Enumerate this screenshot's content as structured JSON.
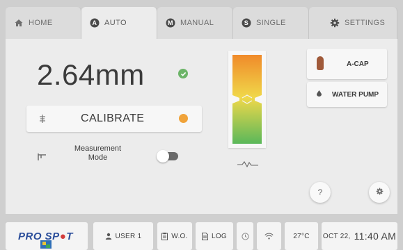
{
  "tabs": [
    {
      "label": "HOME",
      "icon": "home-icon",
      "active": false
    },
    {
      "label": "AUTO",
      "icon": "auto-a-icon",
      "active": true
    },
    {
      "label": "MANUAL",
      "icon": "manual-m-icon",
      "active": false
    },
    {
      "label": "SINGLE",
      "icon": "single-s-icon",
      "active": false
    },
    {
      "label": "SETTINGS",
      "icon": "gear-icon",
      "active": false
    }
  ],
  "main": {
    "measurement": "2.64mm",
    "measurement_status_icon": "check-circle-icon",
    "calibrate_label": "CALIBRATE",
    "calibrate_status_icon": "warning-dot-icon",
    "measurement_mode_label": "Measurement\nMode",
    "measurement_mode_on": false,
    "gauge_icon": "waveform-icon"
  },
  "side": {
    "acap_label": "A-CAP",
    "water_pump_label": "WATER PUMP",
    "help_label": "?"
  },
  "footer": {
    "brand": "PRO SP",
    "brand_dot": "●",
    "brand_end": "T",
    "user_label": "USER 1",
    "wo_label": "W.O.",
    "log_label": "LOG",
    "temp_label": "27°C",
    "date_label": "OCT 22,",
    "time_label": "11:40 AM"
  },
  "colors": {
    "ok": "#6cb468",
    "warning": "#f0a33a",
    "brand_blue": "#2a4d9a",
    "brand_red": "#d23c3c",
    "gauge_top": "#f08a2a",
    "gauge_mid": "#f0d84a",
    "gauge_bottom": "#5ab85a"
  }
}
